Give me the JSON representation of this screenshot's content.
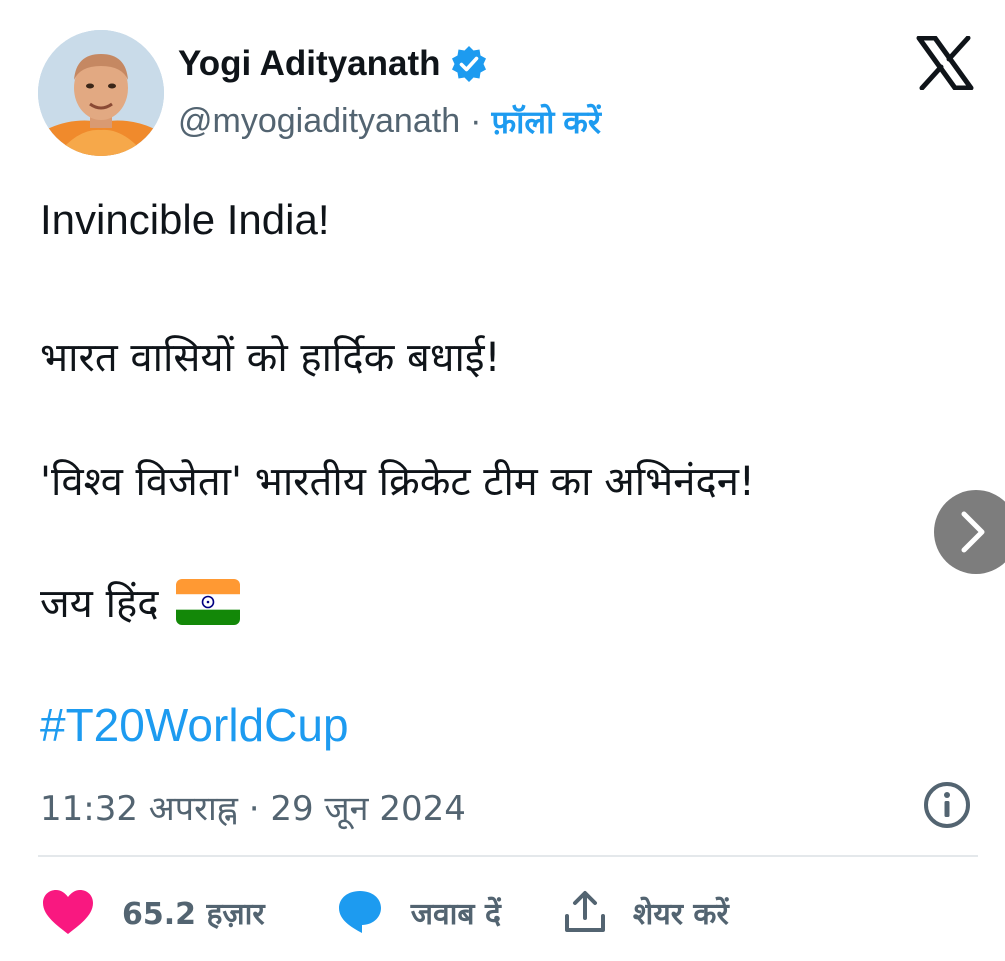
{
  "author": {
    "name": "Yogi Adityanath",
    "handle": "@myogiadityanath",
    "separator": "·",
    "follow_label": "फ़ॉलो करें"
  },
  "tweet": {
    "line1": "Invincible India!",
    "line2": "भारत वासियों को हार्दिक बधाई!",
    "line3": "'विश्व विजेता' भारतीय क्रिकेट टीम का अभिनंदन!",
    "line4": "जय हिंद",
    "hashtag": "#T20WorldCup",
    "flag_icon": "india-flag-icon"
  },
  "meta": {
    "timestamp": "11:32 अपराह्न · 29 जून 2024"
  },
  "actions": {
    "like_count": "65.2 हज़ार",
    "reply_label": "जवाब दें",
    "share_label": "शेयर करें"
  },
  "icons": {
    "platform": "x-logo-icon",
    "verified": "verified-badge-icon",
    "info": "info-icon",
    "next": "chevron-right-icon",
    "like": "heart-icon",
    "reply": "reply-bubble-icon",
    "share": "share-icon"
  },
  "colors": {
    "accent": "#1d9bf0",
    "text": "#0f1419",
    "muted": "#536471",
    "like": "#f91880",
    "divider": "#e4e8eb"
  }
}
